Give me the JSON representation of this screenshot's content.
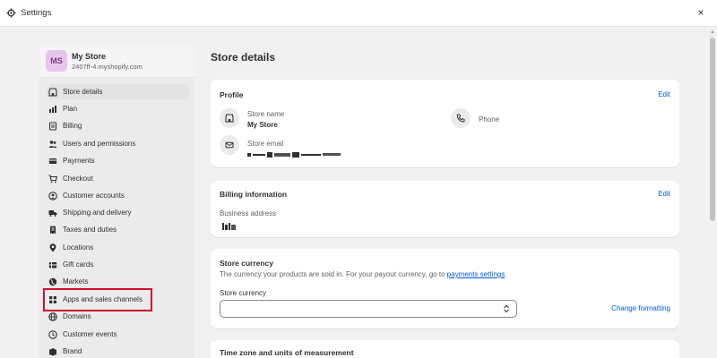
{
  "window": {
    "title": "Settings",
    "close_glyph": "×"
  },
  "store": {
    "initials": "MS",
    "name": "My Store",
    "domain": "2407ff-4.myshopify.com"
  },
  "nav": [
    {
      "label": "Store details",
      "icon": "store-icon"
    },
    {
      "label": "Plan",
      "icon": "plan-icon"
    },
    {
      "label": "Billing",
      "icon": "billing-icon"
    },
    {
      "label": "Users and permissions",
      "icon": "users-icon"
    },
    {
      "label": "Payments",
      "icon": "payments-icon"
    },
    {
      "label": "Checkout",
      "icon": "cart-icon"
    },
    {
      "label": "Customer accounts",
      "icon": "customer-icon"
    },
    {
      "label": "Shipping and delivery",
      "icon": "truck-icon"
    },
    {
      "label": "Taxes and duties",
      "icon": "receipt-icon"
    },
    {
      "label": "Locations",
      "icon": "location-icon"
    },
    {
      "label": "Gift cards",
      "icon": "gift-card-icon"
    },
    {
      "label": "Markets",
      "icon": "globe-icon"
    },
    {
      "label": "Apps and sales channels",
      "icon": "apps-icon"
    },
    {
      "label": "Domains",
      "icon": "globe-icon"
    },
    {
      "label": "Customer events",
      "icon": "events-icon"
    },
    {
      "label": "Brand",
      "icon": "brand-icon"
    }
  ],
  "main": {
    "title": "Store details",
    "profile": {
      "title": "Profile",
      "edit": "Edit",
      "store_name_label": "Store name",
      "store_name_value": "My Store",
      "phone_label": "Phone",
      "store_email_label": "Store email"
    },
    "billing": {
      "title": "Billing information",
      "edit": "Edit",
      "address_label": "Business address"
    },
    "currency": {
      "title": "Store currency",
      "desc_prefix": "The currency your products are sold in. For your payout currency, go to ",
      "desc_link": "payments settings",
      "desc_suffix": ".",
      "field_label": "Store currency",
      "field_value": "",
      "change_formatting": "Change formatting"
    },
    "timezone": {
      "title": "Time zone and units of measurement"
    }
  },
  "colors": {
    "accent_link": "#005bd3",
    "highlight": "#d0112b",
    "avatar_bg": "#e8c5ee"
  }
}
